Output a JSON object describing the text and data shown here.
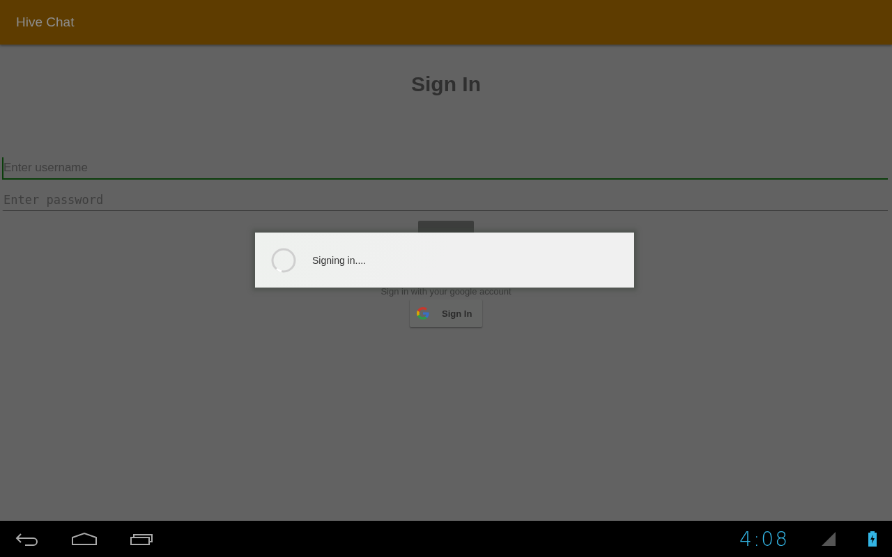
{
  "app_bar": {
    "title": "Hive Chat"
  },
  "heading": "Sign In",
  "fields": [
    {
      "placeholder": "Enter username",
      "kind": "text",
      "focused": true
    },
    {
      "placeholder": "Enter password",
      "kind": "password",
      "focused": false
    }
  ],
  "google": {
    "hint": "Sign in with your google account",
    "button": "Sign In"
  },
  "dialog": {
    "message": "Signing in...."
  },
  "status_bar": {
    "time": "4:08"
  }
}
